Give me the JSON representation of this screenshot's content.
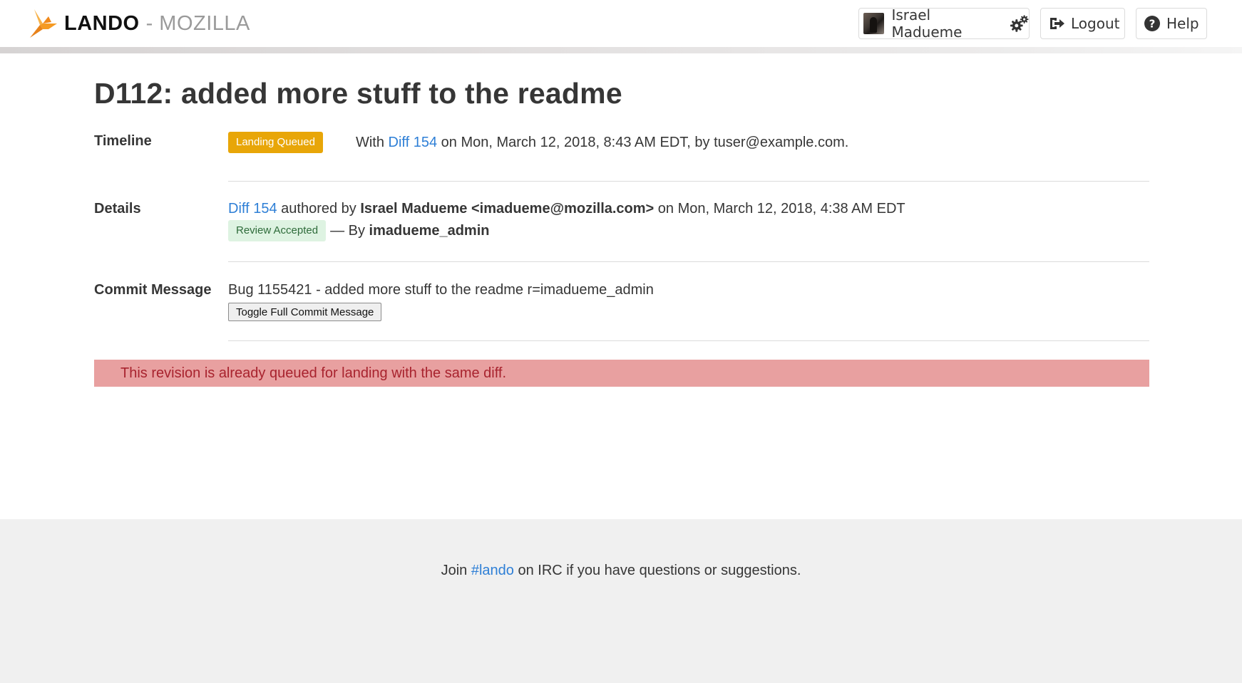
{
  "header": {
    "brand_name": "LANDO",
    "brand_separator": "-",
    "brand_org": "MOZILLA",
    "user_name": "Israel Madueme",
    "logout_label": "Logout",
    "help_label": "Help"
  },
  "page": {
    "title": "D112: added more stuff to the readme"
  },
  "timeline": {
    "label": "Timeline",
    "status_tag": "Landing Queued",
    "prefix": "With",
    "diff_link": "Diff 154",
    "suffix": "on Mon, March 12, 2018, 8:43 AM EDT, by tuser@example.com."
  },
  "details": {
    "label": "Details",
    "diff_link": "Diff 154",
    "authored_by": "authored by",
    "author": "Israel Madueme <imadueme@mozilla.com>",
    "date": "on Mon, March 12, 2018, 4:38 AM EDT",
    "review_tag": "Review Accepted",
    "review_by_prefix": "— By",
    "reviewer": "imadueme_admin"
  },
  "commit": {
    "label": "Commit Message",
    "message": "Bug 1155421 - added more stuff to the readme r=imadueme_admin",
    "toggle_label": "Toggle Full Commit Message"
  },
  "notification": {
    "text": "This revision is already queued for landing with the same diff."
  },
  "footer": {
    "prefix": "Join",
    "irc_link": "#lando",
    "suffix": "on IRC if you have questions or suggestions."
  },
  "colors": {
    "link": "#2e7fd6",
    "warning_tag": "#e8a608",
    "success_tag_bg": "#def3e2",
    "danger_bg": "#e8a0a0",
    "danger_text": "#a8232e",
    "logo_orange": "#f59a23"
  },
  "icons": {
    "logo": "lando-bird-logo",
    "user_settings": "gear-icon",
    "logout": "sign-out-icon",
    "help": "question-circle-icon"
  }
}
